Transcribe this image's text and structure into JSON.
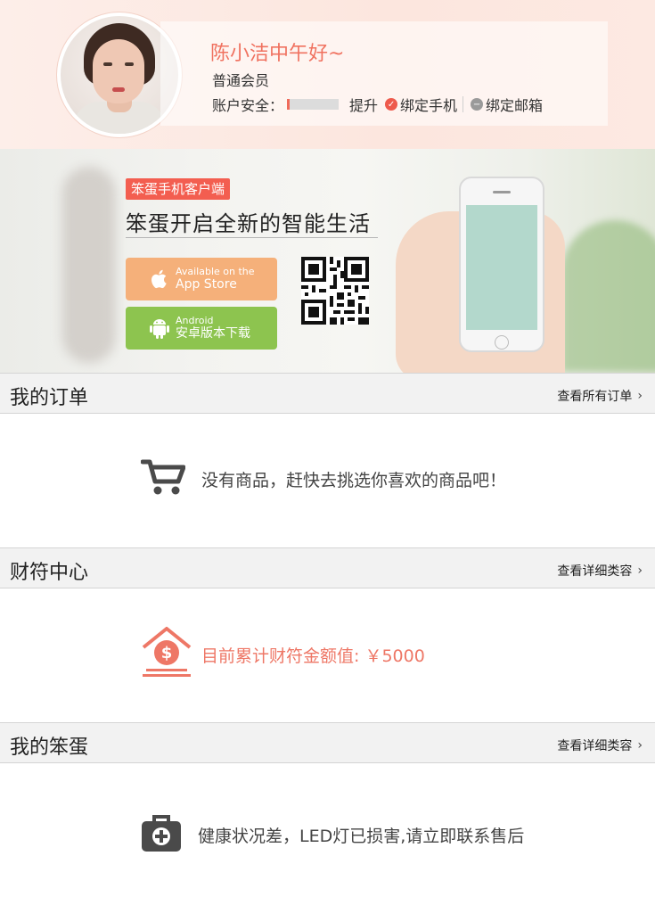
{
  "header": {
    "greeting": "陈小洁中午好~",
    "member_level": "普通会员",
    "security_label": "账户安全：",
    "security_level": 0.05,
    "upgrade_label": "提升",
    "bind_phone_label": "绑定手机",
    "bind_email_label": "绑定邮箱"
  },
  "banner": {
    "tag": "笨蛋手机客户端",
    "slogan": "笨蛋开启全新的智能生活",
    "ios_small": "Available on the",
    "ios_big": "App Store",
    "android_small": "Android",
    "android_big": "安卓版本下载"
  },
  "orders": {
    "title": "我的订单",
    "more_label": "查看所有订单",
    "empty_message": "没有商品，赶快去挑选你喜欢的商品吧！"
  },
  "wealth": {
    "title": "财符中心",
    "more_label": "查看详细类容",
    "total_label": "目前累计财符金额值: ￥5000"
  },
  "my_egg": {
    "title": "我的笨蛋",
    "more_label": "查看详细类容",
    "status_message": "健康状况差，LED灯已损害,请立即联系售后"
  },
  "colors": {
    "accent": "#f07260",
    "ios_button": "#f5b07a",
    "android_button": "#8dc44f",
    "section_header_bg": "#f2f2f2"
  },
  "icons": {
    "cart": "shopping-cart-icon",
    "wealth": "money-house-icon",
    "medical": "medical-kit-icon"
  }
}
